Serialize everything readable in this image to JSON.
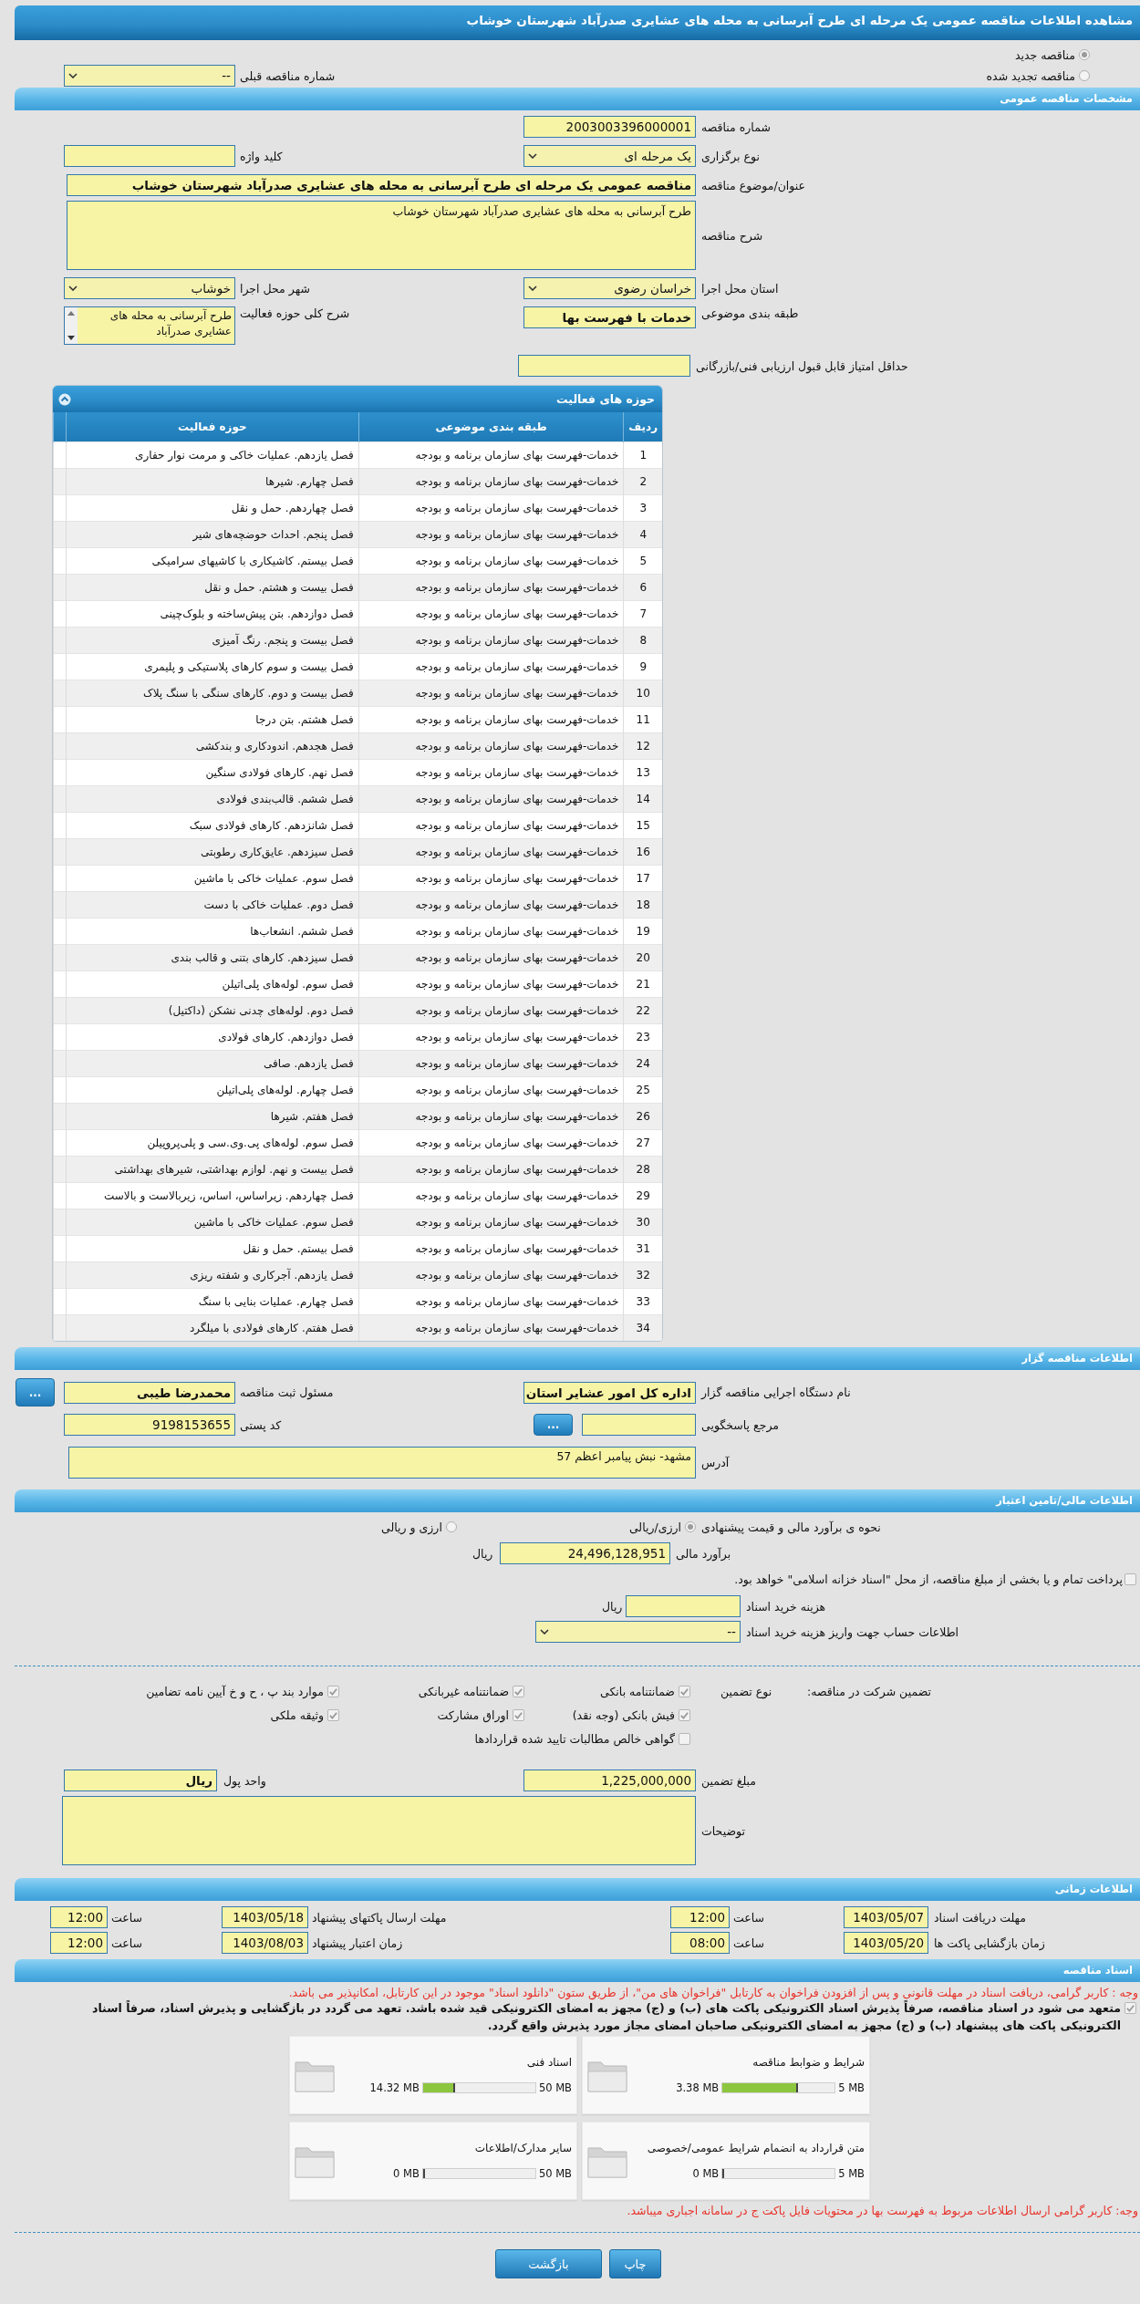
{
  "title": "مشاهده اطلاعات مناقصه عمومی یک مرحله ای طرح آبرسانی به محله های عشایری صدرآباد شهرستان خوشاب",
  "tender_type": [
    {
      "label": "مناقصه جدید",
      "selected": true
    },
    {
      "label": "مناقصه تجدید شده",
      "selected": false
    }
  ],
  "previous_tender": {
    "label": "شماره مناقصه قبلی",
    "value": "--"
  },
  "general": {
    "header": "مشخصات مناقصه عمومی",
    "tender_number": {
      "label": "شماره مناقصه",
      "value": "2003003396000001"
    },
    "holding_type": {
      "label": "نوع برگزاری",
      "value": "یک مرحله ای"
    },
    "keyword": {
      "label": "کلید واژه"
    },
    "subject": {
      "label": "عنوان/موضوع مناقصه",
      "value": "مناقصه عمومی یک مرحله ای طرح آبرسانی به محله های عشایری صدرآباد شهرستان خوشاب"
    },
    "description": {
      "label": "شرح مناقصه",
      "value": "طرح آبرسانی به محله های عشایری صدرآباد شهرستان خوشاب"
    },
    "province": {
      "label": "استان محل اجرا",
      "value": "خراسان رضوی"
    },
    "city": {
      "label": "شهر محل اجرا",
      "value": "خوشاب"
    },
    "category": {
      "label": "طبقه بندی موضوعی",
      "value": "خدمات با فهرست بها"
    },
    "activity_summary": {
      "label": "شرح کلی حوزه فعالیت",
      "value": "طرح آبرسانی به محله های عشایری صدرآباد"
    },
    "min_score": {
      "label": "حداقل امتیاز قابل قبول ارزیابی فنی/بازرگانی"
    }
  },
  "activities": {
    "title": "حوزه های فعالیت",
    "columns": [
      "ردیف",
      "طبقه بندی موضوعی",
      "حوزه فعالیت"
    ],
    "rows": [
      {
        "index": "1",
        "category": "خدمات-فهرست بهای سازمان برنامه و بودجه",
        "activity": "فصل یازدهم. عملیات خاکی و مرمت نوار حفاری"
      },
      {
        "index": "2",
        "category": "خدمات-فهرست بهای سازمان برنامه و بودجه",
        "activity": "فصل چهارم. شیرها"
      },
      {
        "index": "3",
        "category": "خدمات-فهرست بهای سازمان برنامه و بودجه",
        "activity": "فصل چهاردهم. حمل و نقل"
      },
      {
        "index": "4",
        "category": "خدمات-فهرست بهای سازمان برنامه و بودجه",
        "activity": "فصل پنجم. احداث حوضچه‌های شیر"
      },
      {
        "index": "5",
        "category": "خدمات-فهرست بهای سازمان برنامه و بودجه",
        "activity": "فصل بیستم. کاشیکاری با کاشیهای سرامیکی"
      },
      {
        "index": "6",
        "category": "خدمات-فهرست بهای سازمان برنامه و بودجه",
        "activity": "فصل بیست و هشتم. حمل و نقل"
      },
      {
        "index": "7",
        "category": "خدمات-فهرست بهای سازمان برنامه و بودجه",
        "activity": "فصل دوازدهم. بتن پیش‌ساخته و بلوک‌چینی"
      },
      {
        "index": "8",
        "category": "خدمات-فهرست بهای سازمان برنامه و بودجه",
        "activity": "فصل بیست و پنجم. رنگ آمیزی"
      },
      {
        "index": "9",
        "category": "خدمات-فهرست بهای سازمان برنامه و بودجه",
        "activity": "فصل بیست و سوم کارهای پلاستیکی و پلیمری"
      },
      {
        "index": "10",
        "category": "خدمات-فهرست بهای سازمان برنامه و بودجه",
        "activity": "فصل بیست و دوم. کارهای سنگی با سنگ پلاک"
      },
      {
        "index": "11",
        "category": "خدمات-فهرست بهای سازمان برنامه و بودجه",
        "activity": "فصل هشتم. بتن درجا"
      },
      {
        "index": "12",
        "category": "خدمات-فهرست بهای سازمان برنامه و بودجه",
        "activity": "فصل هجدهم. اندودکاری و بندکشی"
      },
      {
        "index": "13",
        "category": "خدمات-فهرست بهای سازمان برنامه و بودجه",
        "activity": "فصل نهم. کارهای فولادی سنگین"
      },
      {
        "index": "14",
        "category": "خدمات-فهرست بهای سازمان برنامه و بودجه",
        "activity": "فصل ششم. قالب‌بندی فولادی"
      },
      {
        "index": "15",
        "category": "خدمات-فهرست بهای سازمان برنامه و بودجه",
        "activity": "فصل شانزدهم. کارهای فولادی سبک"
      },
      {
        "index": "16",
        "category": "خدمات-فهرست بهای سازمان برنامه و بودجه",
        "activity": "فصل سیزدهم. عایق‌کاری رطوبتی"
      },
      {
        "index": "17",
        "category": "خدمات-فهرست بهای سازمان برنامه و بودجه",
        "activity": "فصل سوم. عملیات خاکی با ماشین"
      },
      {
        "index": "18",
        "category": "خدمات-فهرست بهای سازمان برنامه و بودجه",
        "activity": "فصل دوم. عملیات خاکی با دست"
      },
      {
        "index": "19",
        "category": "خدمات-فهرست بهای سازمان برنامه و بودجه",
        "activity": "فصل ششم. انشعاب‌ها"
      },
      {
        "index": "20",
        "category": "خدمات-فهرست بهای سازمان برنامه و بودجه",
        "activity": "فصل سیزدهم. کارهای بتنی و قالب بندی"
      },
      {
        "index": "21",
        "category": "خدمات-فهرست بهای سازمان برنامه و بودجه",
        "activity": "فصل سوم. لوله‌های پلی‌اتیلن"
      },
      {
        "index": "22",
        "category": "خدمات-فهرست بهای سازمان برنامه و بودجه",
        "activity": "فصل دوم. لوله‌های چدنی نشکن (داکتیل)"
      },
      {
        "index": "23",
        "category": "خدمات-فهرست بهای سازمان برنامه و بودجه",
        "activity": "فصل دوازدهم. کارهای فولادی"
      },
      {
        "index": "24",
        "category": "خدمات-فهرست بهای سازمان برنامه و بودجه",
        "activity": "فصل یازدهم. صافی"
      },
      {
        "index": "25",
        "category": "خدمات-فهرست بهای سازمان برنامه و بودجه",
        "activity": "فصل چهارم. لوله‌های پلی‌اتیلن"
      },
      {
        "index": "26",
        "category": "خدمات-فهرست بهای سازمان برنامه و بودجه",
        "activity": "فصل هفتم. شیرها"
      },
      {
        "index": "27",
        "category": "خدمات-فهرست بهای سازمان برنامه و بودجه",
        "activity": "فصل سوم. لوله‌های پی.وی.سی و پلی‌پروپیلن"
      },
      {
        "index": "28",
        "category": "خدمات-فهرست بهای سازمان برنامه و بودجه",
        "activity": "فصل بیست و نهم. لوازم بهداشتی، شیرهای بهداشتی"
      },
      {
        "index": "29",
        "category": "خدمات-فهرست بهای سازمان برنامه و بودجه",
        "activity": "فصل چهاردهم. زیراساس، اساس، زیربالاست و بالاست"
      },
      {
        "index": "30",
        "category": "خدمات-فهرست بهای سازمان برنامه و بودجه",
        "activity": "فصل سوم. عملیات خاکی با ماشین"
      },
      {
        "index": "31",
        "category": "خدمات-فهرست بهای سازمان برنامه و بودجه",
        "activity": "فصل بیستم. حمل و نقل"
      },
      {
        "index": "32",
        "category": "خدمات-فهرست بهای سازمان برنامه و بودجه",
        "activity": "فصل یازدهم. آجرکاری و شفته ریزی"
      },
      {
        "index": "33",
        "category": "خدمات-فهرست بهای سازمان برنامه و بودجه",
        "activity": "فصل چهارم. عملیات بنایی با سنگ"
      },
      {
        "index": "34",
        "category": "خدمات-فهرست بهای سازمان برنامه و بودجه",
        "activity": "فصل هفتم. کارهای فولادی با میلگرد"
      }
    ]
  },
  "organizer": {
    "header": "اطلاعات مناقصه گزار",
    "agency": {
      "label": "نام دستگاه اجرایی مناقصه گزار",
      "value": "اداره کل امور عشایر استان"
    },
    "registrar": {
      "label": "مسئول ثبت مناقصه",
      "value": "محمدرضا طیبی",
      "button": "..."
    },
    "responder": {
      "label": "مرجع پاسخگویی",
      "button": "..."
    },
    "postal_code": {
      "label": "کد پستی",
      "value": "9198153655"
    },
    "address": {
      "label": "آدرس",
      "value": "مشهد- نبش پیامبر اعظم 57"
    }
  },
  "finance": {
    "header": "اطلاعات مالی/تامین اعتبار",
    "estimate_method": {
      "label": "نحوه ی برآورد مالی و قیمت پیشنهادی",
      "options": [
        {
          "label": "ارزی/ریالی",
          "selected": true
        },
        {
          "label": "ارزی و ریالی",
          "selected": false
        }
      ]
    },
    "estimate": {
      "label": "برآورد مالی",
      "value": "24,496,128,951",
      "unit": "ریال"
    },
    "treasury": {
      "label": "پرداخت تمام و یا بخشی از مبلغ مناقصه، از محل \"اسناد خزانه اسلامی\" خواهد بود.",
      "checked": false
    },
    "doc_fee": {
      "label": "هزینه خرید اسناد",
      "unit": "ریال"
    },
    "account": {
      "label": "اطلاعات حساب جهت واریز هزینه خرید اسناد",
      "value": "--"
    }
  },
  "guarantee": {
    "label": "تضمین شرکت در مناقصه:",
    "type_label": "نوع تضمین",
    "options": [
      {
        "label": "ضمانتنامه بانکی",
        "checked": true
      },
      {
        "label": "ضمانتنامه غیربانکی",
        "checked": true
      },
      {
        "label": "موارد بند پ ، ح و خ آیین نامه تضامین",
        "checked": true
      },
      {
        "label": "فیش بانکی (وجه نقد)",
        "checked": true
      },
      {
        "label": "اوراق مشارکت",
        "checked": true
      },
      {
        "label": "وثیقه ملکی",
        "checked": true
      },
      {
        "label": "گواهی خالص مطالبات تایید شده قراردادها",
        "checked": false
      }
    ],
    "amount": {
      "label": "مبلغ تضمین",
      "value": "1,225,000,000"
    },
    "currency": {
      "label": "واحد پول",
      "value": "ریال"
    },
    "notes": {
      "label": "توضیحات"
    }
  },
  "schedule": {
    "header": "اطلاعات زمانی",
    "items": [
      {
        "label": "مهلت دریافت اسناد",
        "date": "1403/05/07",
        "time_label": "ساعت",
        "time": "12:00"
      },
      {
        "label": "مهلت ارسال پاکتهای پیشنهاد",
        "date": "1403/05/18",
        "time_label": "ساعت",
        "time": "12:00"
      },
      {
        "label": "زمان بازگشایی پاکت ها",
        "date": "1403/05/20",
        "time_label": "ساعت",
        "time": "08:00"
      },
      {
        "label": "زمان اعتبار پیشنهاد",
        "date": "1403/08/03",
        "time_label": "ساعت",
        "time": "12:00"
      }
    ]
  },
  "documents": {
    "header": "اسناد مناقصه",
    "notice": "وجه : کاربر گرامی، دریافت اسناد در مهلت قانونی و پس از افزودن فراخوان به کارتابل \"فراخوان های من\"، از طریق ستون \"دانلود اسناد\" موجود در این کارتابل، امکانپذیر می باشد.",
    "pledge": {
      "text": "متعهد می شود در اسناد مناقصه، صرفاً پذیرش اسناد الکترونیکی پاکت های (ب) و (ج) مجهز به امضای الکترونیکی قید شده باشد. تعهد می گردد در بازگشایی و پذیرش اسناد، صرفاً اسناد الکترونیکی پاکت های پیشنهاد (ب) و (ج) مجهز به امضای الکترونیکی صاحبان امضای مجاز مورد پذیرش واقع گردد.",
      "checked": true
    },
    "files": [
      {
        "name": "شرایط و ضوابط مناقصه",
        "size": "3.38 MB",
        "max": "5 MB",
        "level": 0.676
      },
      {
        "name": "اسناد فنی",
        "size": "14.32 MB",
        "max": "50 MB",
        "level": 0.286
      },
      {
        "name": "متن قرارداد به انضمام شرایط عمومی/خصوصی",
        "size": "0 MB",
        "max": "5 MB",
        "level": 0
      },
      {
        "name": "سایر مدارک/اطلاعات",
        "size": "0 MB",
        "max": "50 MB",
        "level": 0
      }
    ],
    "footnote": "وجه: کاربر گرامی ارسال اطلاعات مربوط به فهرست بها در محتویات فایل پاکت ج در سامانه اجباری میباشد."
  },
  "actions": [
    {
      "label": "چاپ"
    },
    {
      "label": "بازگشت"
    }
  ]
}
